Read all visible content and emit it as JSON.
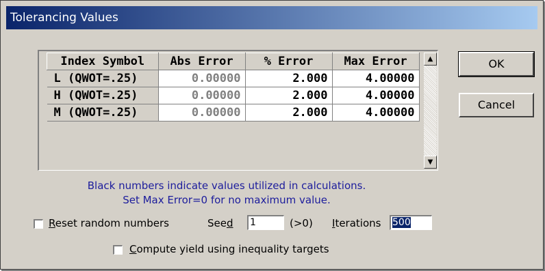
{
  "window": {
    "title": "Tolerancing Values"
  },
  "table": {
    "headers": [
      "Index Symbol",
      "Abs Error",
      "% Error",
      "Max Error"
    ],
    "rows": [
      {
        "symbol": "L (QWOT=.25)",
        "abs": "0.00000",
        "pct": "2.000",
        "max": "4.00000"
      },
      {
        "symbol": "H (QWOT=.25)",
        "abs": "0.00000",
        "pct": "2.000",
        "max": "4.00000"
      },
      {
        "symbol": "M (QWOT=.25)",
        "abs": "0.00000",
        "pct": "2.000",
        "max": "4.00000"
      }
    ]
  },
  "buttons": {
    "ok": "OK",
    "cancel": "Cancel"
  },
  "info": {
    "line1": "Black numbers indicate values utilized in calculations.",
    "line2": "Set Max Error=0 for no maximum value."
  },
  "options": {
    "reset_random": {
      "label_pre": "",
      "label_u": "R",
      "label_post": "eset random numbers",
      "checked": false
    },
    "seed": {
      "label_pre": "See",
      "label_u": "d",
      "value": "1",
      "hint": "(>0)"
    },
    "iterations": {
      "label_u": "I",
      "label_post": "terations",
      "value": "500"
    },
    "compute_yield": {
      "label_u": "C",
      "label_post": "ompute yield using inequality targets",
      "checked": false
    }
  },
  "colors": {
    "title_start": "#0a246a",
    "title_end": "#a6caf0",
    "info_text": "#1c1c9c",
    "disabled_value": "#808080"
  }
}
